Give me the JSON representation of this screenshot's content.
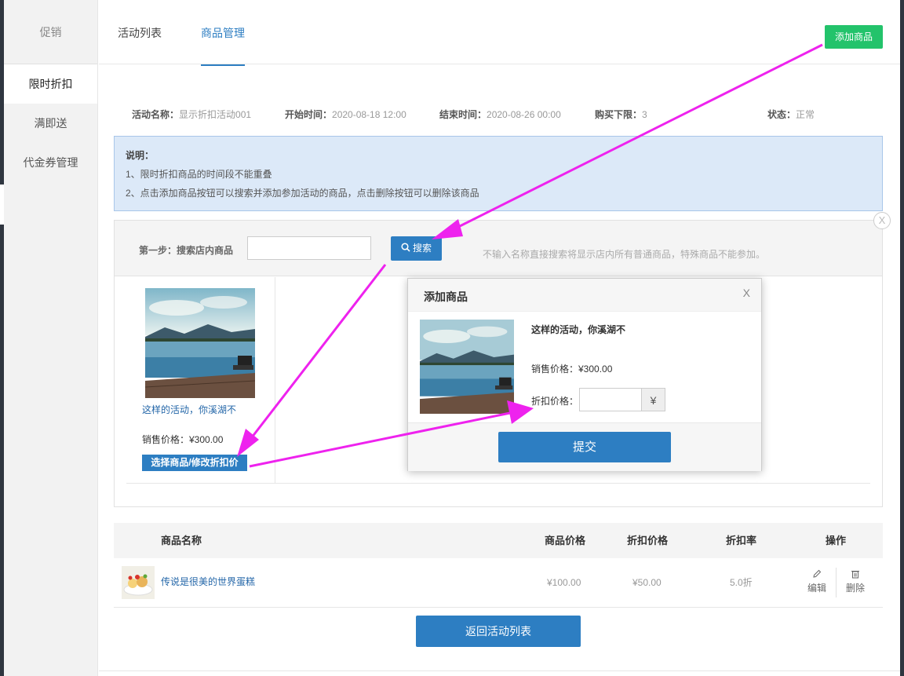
{
  "sidebar": {
    "header": "促销",
    "items": [
      {
        "label": "限时折扣",
        "active": true
      },
      {
        "label": "满即送",
        "active": false
      },
      {
        "label": "代金券管理",
        "active": false
      }
    ]
  },
  "tabs": [
    {
      "label": "活动列表",
      "active": false
    },
    {
      "label": "商品管理",
      "active": true
    }
  ],
  "top_add_button": "添加商品",
  "activity": {
    "name_label": "活动名称：",
    "name_value": "显示折扣活动001",
    "start_label": "开始时间：",
    "start_value": "2020-08-18 12:00",
    "end_label": "结束时间：",
    "end_value": "2020-08-26 00:00",
    "min_label": "购买下限：",
    "min_value": "3",
    "status_label": "状态：",
    "status_value": "正常"
  },
  "notice": {
    "title": "说明：",
    "line1": "1、限时折扣商品的时间段不能重叠",
    "line2": "2、点击添加商品按钮可以搜索并添加参加活动的商品，点击删除按钮可以删除该商品"
  },
  "search": {
    "step_label": "第一步：搜索店内商品",
    "input_value": "",
    "button_label": "搜索",
    "hint": "不输入名称直接搜索将显示店内所有普通商品，特殊商品不能参加。",
    "close": "X"
  },
  "product": {
    "name": "这样的活动，你溪湖不",
    "price": "销售价格：¥300.00",
    "select_button": "选择商品/修改折扣价"
  },
  "table": {
    "headers": {
      "name": "商品名称",
      "price": "商品价格",
      "discount_price": "折扣价格",
      "rate": "折扣率",
      "ops": "操作"
    },
    "rows": [
      {
        "name": "传说是很美的世界蛋糕",
        "price": "¥100.00",
        "discount_price": "¥50.00",
        "rate": "5.0折",
        "edit": "编辑",
        "delete": "删除"
      }
    ]
  },
  "back_button": "返回活动列表",
  "modal": {
    "title": "添加商品",
    "close": "X",
    "product_name": "这样的活动，你溪湖不",
    "price": "销售价格：¥300.00",
    "discount_label": "折扣价格：",
    "discount_value": "",
    "currency_symbol": "¥",
    "submit": "提交"
  },
  "colors": {
    "primary": "#2d7ec2",
    "success": "#23c36b",
    "annotation": "#ee22ee"
  }
}
